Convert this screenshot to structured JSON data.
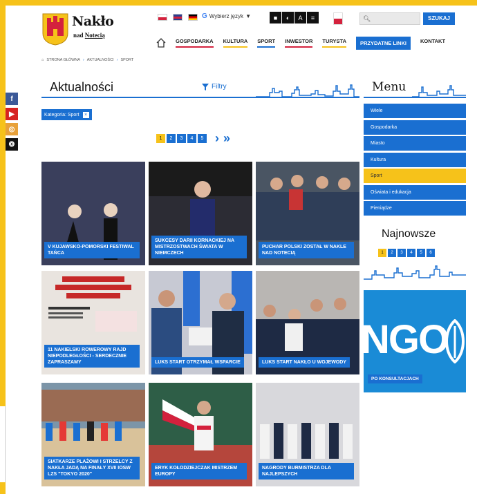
{
  "header": {
    "logo_title": "Nakło",
    "logo_sub_1": "nad",
    "logo_sub_2": "Notecią",
    "translate_label": "Wybierz język",
    "translate_arrow": "▼",
    "search_placeholder": "",
    "search_button": "SZUKAJ",
    "accessibility": [
      "■",
      "◐",
      "A",
      "≡"
    ]
  },
  "nav": {
    "items": [
      {
        "label": "GOSPODARKA",
        "accent": "red"
      },
      {
        "label": "KULTURA",
        "accent": "yellow"
      },
      {
        "label": "SPORT",
        "accent": "blue"
      },
      {
        "label": "INWESTOR",
        "accent": "red"
      },
      {
        "label": "TURYSTA",
        "accent": "yellow"
      },
      {
        "label": "PRZYDATNE LINKI",
        "accent": "active"
      },
      {
        "label": "KONTAKT",
        "accent": "none"
      }
    ]
  },
  "breadcrumb": {
    "items": [
      "STRONA GŁÓWNA",
      "AKTUALNOŚCI",
      "SPORT"
    ],
    "separator": "›"
  },
  "main": {
    "title": "Aktualności",
    "filter_label": "Filtry",
    "category_label": "Kategoria: Sport",
    "category_clear": "×",
    "pager": {
      "pages": [
        "1",
        "2",
        "3",
        "4",
        "5"
      ],
      "next": "›",
      "last": "»"
    }
  },
  "tiles": [
    {
      "caption": "V KUJAWSKO-POMORSKI FESTIWAL TAŃCA",
      "bg": "#3a3f5c"
    },
    {
      "caption": "SUKCESY DARII KORNACKIEJ NA MISTRZOSTWACH ŚWIATA W NIEMCZECH",
      "bg": "#2c2c34"
    },
    {
      "caption": "PUCHAR POLSKI ZOSTAŁ W NAKLE NAD NOTECIĄ",
      "bg": "#4a5563"
    },
    {
      "caption": "11 NAKIELSKI ROWEROWY RAJD NIEPODLEGŁOŚCI - SERDECZNIE ZAPRASZAMY",
      "bg": "#e9e4df"
    },
    {
      "caption": "LUKS START OTRZYMAŁ WSPARCIE",
      "bg": "#c7c9d3"
    },
    {
      "caption": "LUKS START NAKŁO U WOJEWODY",
      "bg": "#b9b6b3"
    },
    {
      "caption": "SIATKARZE PLAŻOWI I STRZELCY Z NAKŁA JADĄ NA FINAŁY XVII IOSW LZS \"TOKYO 2020\"",
      "bg": "#7c95a8"
    },
    {
      "caption": "ERYK KOŁODZIEJCZAK MISTRZEM EUROPY",
      "bg": "#2e5e47"
    },
    {
      "caption": "NAGRODY BURMISTRZA DLA NAJLEPSZYCH",
      "bg": "#d8d8dc"
    }
  ],
  "sidebar": {
    "menu_title": "Menu",
    "menu_items": [
      {
        "label": "Wiele",
        "active": false
      },
      {
        "label": "Gospodarka",
        "active": false
      },
      {
        "label": "Miasto",
        "active": false
      },
      {
        "label": "Kultura",
        "active": false
      },
      {
        "label": "Sport",
        "active": true
      },
      {
        "label": "Oświata i edukacja",
        "active": false
      },
      {
        "label": "Pieniądze",
        "active": false
      }
    ],
    "newest_title": "Najnowsze",
    "newest_pages": [
      "1",
      "2",
      "3",
      "4",
      "5",
      "6"
    ],
    "ngo_text": "NGO",
    "ngo_caption": "PO KONSULTACJACH"
  },
  "social": [
    "f",
    "▶",
    "◎",
    "❂"
  ],
  "colors": {
    "brand_blue": "#1a6fd1",
    "brand_yellow": "#f6c21a",
    "brand_red": "#d4213d"
  }
}
